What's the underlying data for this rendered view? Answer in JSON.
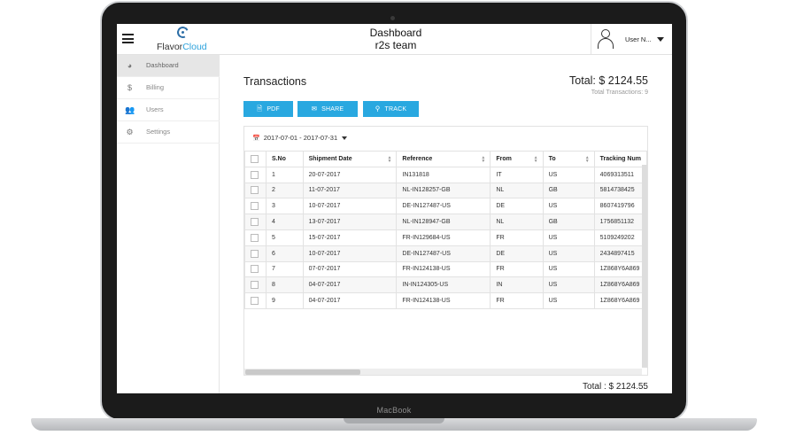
{
  "header": {
    "logo_a": "Flavor",
    "logo_b": "Cloud",
    "title": "Dashboard",
    "subtitle": "r2s team",
    "user": "User N..."
  },
  "sidebar": {
    "items": [
      {
        "label": "Dashboard",
        "icon": "dashboard-icon"
      },
      {
        "label": "Billing",
        "icon": "dollar-icon"
      },
      {
        "label": "Users",
        "icon": "users-icon"
      },
      {
        "label": "Settings",
        "icon": "gear-icon"
      }
    ]
  },
  "main": {
    "title": "Transactions",
    "total": "Total: $ 2124.55",
    "total_sub": "Total Transactions: 9",
    "buttons": {
      "pdf": "PDF",
      "share": "SHARE",
      "track": "TRACK"
    },
    "date_range": "2017-07-01 - 2017-07-31",
    "footer_total": "Total : $ 2124.55"
  },
  "table": {
    "columns": [
      "S.No",
      "Shipment Date",
      "Reference",
      "From",
      "To",
      "Tracking Num"
    ],
    "rows": [
      [
        "1",
        "20-07-2017",
        "IN131818",
        "IT",
        "US",
        "4069313511"
      ],
      [
        "2",
        "11-07-2017",
        "NL-IN128257-GB",
        "NL",
        "GB",
        "5814738425"
      ],
      [
        "3",
        "10-07-2017",
        "DE-IN127487-US",
        "DE",
        "US",
        "8607419796"
      ],
      [
        "4",
        "13-07-2017",
        "NL-IN128947-GB",
        "NL",
        "GB",
        "1756851132"
      ],
      [
        "5",
        "15-07-2017",
        "FR-IN129684-US",
        "FR",
        "US",
        "5109249202"
      ],
      [
        "6",
        "10-07-2017",
        "DE-IN127487-US",
        "DE",
        "US",
        "2434897415"
      ],
      [
        "7",
        "07-07-2017",
        "FR-IN124138-US",
        "FR",
        "US",
        "1Z868Y6A869"
      ],
      [
        "8",
        "04-07-2017",
        "IN-IN124305-US",
        "IN",
        "US",
        "1Z868Y6A869"
      ],
      [
        "9",
        "04-07-2017",
        "FR-IN124138-US",
        "FR",
        "US",
        "1Z868Y6A869"
      ]
    ]
  },
  "device": {
    "brand": "MacBook"
  },
  "colors": {
    "accent": "#29a8e0",
    "logo_blue": "#2e6fa7"
  }
}
